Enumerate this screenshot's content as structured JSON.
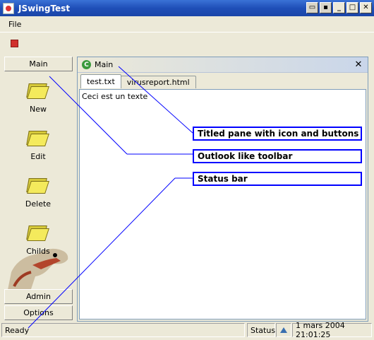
{
  "window": {
    "title": "JSwingTest",
    "buttons": [
      "_",
      "□",
      "✕"
    ]
  },
  "menu": {
    "items": [
      "File"
    ]
  },
  "outlook": {
    "top_button": "Main",
    "items": [
      {
        "label": "New",
        "icon": "folder-icon"
      },
      {
        "label": "Edit",
        "icon": "folder-icon"
      },
      {
        "label": "Delete",
        "icon": "folder-icon"
      },
      {
        "label": "Childs",
        "icon": "folder-icon"
      }
    ],
    "bottom_buttons": [
      "Admin",
      "Options"
    ]
  },
  "pane": {
    "title": "Main",
    "icon_letter": "C",
    "close_glyph": "✕",
    "tabs": [
      "test.txt",
      "virusreport.html"
    ],
    "active_tab": 0,
    "content": "Ceci est un texte"
  },
  "statusbar": {
    "message": "Ready",
    "status_label": "Status",
    "datetime": "1 mars 2004 21:01:25"
  },
  "callouts": [
    "Titled pane with icon and buttons",
    "Outlook like toolbar",
    "Status bar"
  ],
  "colors": {
    "titlebar": "#1f4fb8",
    "callout_border": "#0000ff",
    "folder": "#f4ea5c",
    "pane_icon": "#3b9a3b"
  }
}
